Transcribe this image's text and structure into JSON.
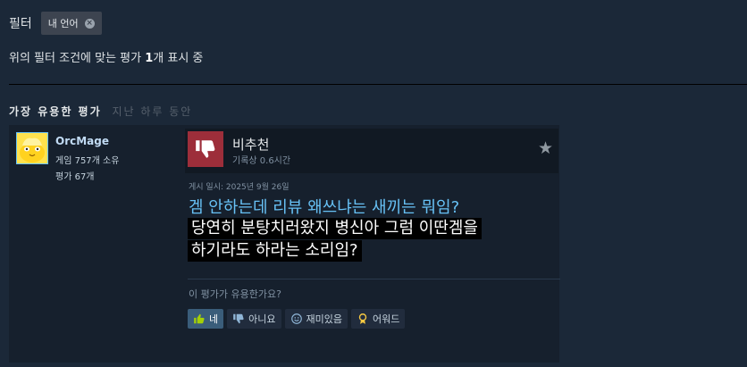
{
  "filter": {
    "label": "필터",
    "chip_label": "내 언어"
  },
  "summary": {
    "prefix": "위의 필터 조건에 맞는 평가 ",
    "count": "1",
    "suffix": "개 표시 중"
  },
  "section": {
    "title": "가장 유용한 평가",
    "period": "지난 하루 동안"
  },
  "review": {
    "author": {
      "name": "OrcMage",
      "games_owned": "게임 757개 소유",
      "reviews_count": "평가 67개"
    },
    "verdict": "비추천",
    "playtime": "기록상 0.6시간",
    "posted": "게시 일시: 2025년 9월 26일",
    "title": "겜 안하는데 리뷰 왜쓰냐는 새끼는 뭐임?",
    "body_line1": "당연히 분탕치러왔지 병신아 그럼 이딴겜을",
    "body_line2": "하기라도 하라는 소리임?",
    "helpful_question": "이 평가가 유용한가요?",
    "buttons": {
      "yes": "네",
      "no": "아니요",
      "funny": "재미있음",
      "award": "어워드"
    }
  },
  "colors": {
    "background": "#1b2838",
    "card": "#16202d",
    "negative": "#9d2e3a",
    "link": "#67c1f5",
    "active_vote": "#3a5d7a"
  },
  "icons": [
    "close-icon",
    "thumbs-down-icon",
    "star-icon",
    "thumbs-up-icon",
    "smiley-icon",
    "award-icon"
  ]
}
